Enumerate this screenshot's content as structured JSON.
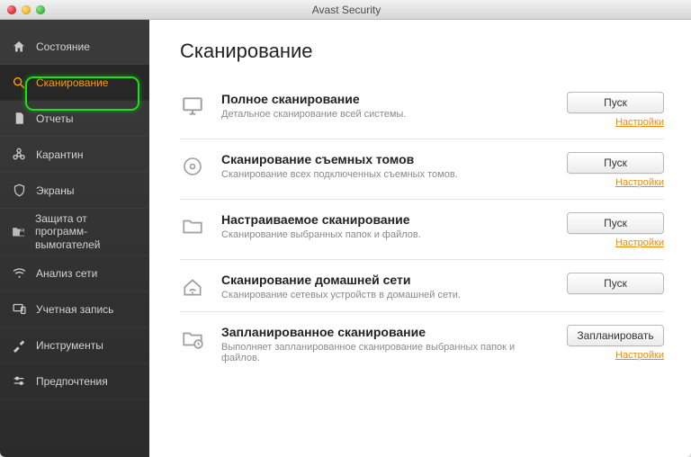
{
  "window": {
    "title": "Avast Security"
  },
  "sidebar": {
    "items": [
      {
        "id": "status",
        "label": "Состояние"
      },
      {
        "id": "scan",
        "label": "Сканирование"
      },
      {
        "id": "reports",
        "label": "Отчеты"
      },
      {
        "id": "quarantine",
        "label": "Карантин"
      },
      {
        "id": "shields",
        "label": "Экраны"
      },
      {
        "id": "ransom",
        "label": "Защита от программ-вымогателей"
      },
      {
        "id": "wifi",
        "label": "Анализ сети"
      },
      {
        "id": "account",
        "label": "Учетная запись"
      },
      {
        "id": "tools",
        "label": "Инструменты"
      },
      {
        "id": "prefs",
        "label": "Предпочтения"
      }
    ],
    "active_index": 1
  },
  "page": {
    "title": "Сканирование"
  },
  "common": {
    "run": "Пуск",
    "settings": "Настройки",
    "schedule": "Запланировать"
  },
  "scans": [
    {
      "title": "Полное сканирование",
      "desc": "Детальное сканирование всей системы.",
      "button": "Пуск",
      "has_settings": true
    },
    {
      "title": "Сканирование съемных томов",
      "desc": "Сканирование всех подключенных съемных томов.",
      "button": "Пуск",
      "has_settings": true
    },
    {
      "title": "Настраиваемое сканирование",
      "desc": "Сканирование выбранных папок и файлов.",
      "button": "Пуск",
      "has_settings": true
    },
    {
      "title": "Сканирование домашней сети",
      "desc": "Сканирование сетевых устройств в домашней сети.",
      "button": "Пуск",
      "has_settings": false
    },
    {
      "title": "Запланированное сканирование",
      "desc": "Выполняет запланированное сканирование выбранных папок и файлов.",
      "button": "Запланировать",
      "has_settings": true
    }
  ]
}
